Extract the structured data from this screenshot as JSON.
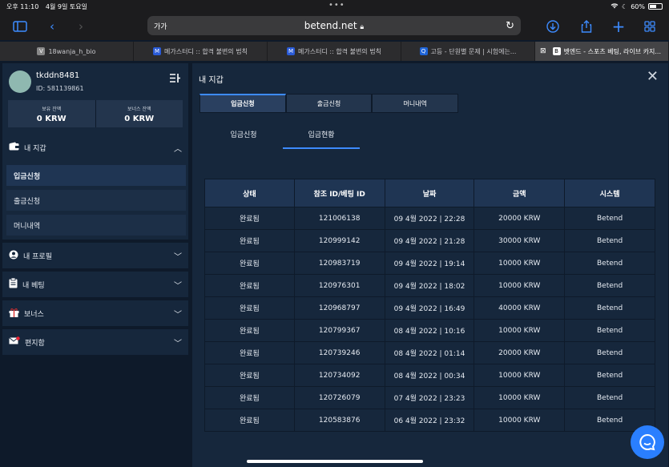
{
  "status": {
    "time": "오후 11:10",
    "date": "4월 9일 토요일",
    "battery": "60%",
    "battery_level": 0.6
  },
  "browser": {
    "aa": "가가",
    "url": "betend.net",
    "tabs": [
      {
        "label": "18wanja_h_bio",
        "fav": "V"
      },
      {
        "label": "메가스터디 :: 합격 불변의 법칙",
        "fav": "M"
      },
      {
        "label": "메가스터디 :: 합격 불변의 법칙",
        "fav": "M"
      },
      {
        "label": "고등 - 단원별 문제 | 시험에는...",
        "fav": "Q"
      },
      {
        "label": "벳엔드 - 스포츠 베팅, 라이브 카지...",
        "fav": "B"
      }
    ]
  },
  "user": {
    "name": "tkddn8481",
    "id": "ID: 581139861"
  },
  "balances": [
    {
      "label": "보유 잔액",
      "value": "0 KRW"
    },
    {
      "label": "보너스 잔액",
      "value": "0 KRW"
    }
  ],
  "sidebar": {
    "wallet": "내 지갑",
    "wallet_items": [
      "입금신청",
      "출금신청",
      "머니내역"
    ],
    "sections": [
      {
        "label": "내 프로필",
        "icon": "user-icon"
      },
      {
        "label": "내 베팅",
        "icon": "clipboard-icon"
      },
      {
        "label": "보너스",
        "icon": "gift-icon"
      },
      {
        "label": "편지함",
        "icon": "mail-icon"
      }
    ]
  },
  "main": {
    "title": "내 지갑",
    "tabs": [
      "입금신청",
      "출금신청",
      "머니내역"
    ],
    "subtabs": [
      "입금신청",
      "입금현황"
    ],
    "columns": [
      "상태",
      "참조 ID/베팅 ID",
      "날짜",
      "금액",
      "시스템"
    ],
    "rows": [
      [
        "완료됨",
        "121006138",
        "09 4월 2022 | 22:28",
        "20000 KRW",
        "Betend"
      ],
      [
        "완료됨",
        "120999142",
        "09 4월 2022 | 21:28",
        "30000 KRW",
        "Betend"
      ],
      [
        "완료됨",
        "120983719",
        "09 4월 2022 | 19:14",
        "10000 KRW",
        "Betend"
      ],
      [
        "완료됨",
        "120976301",
        "09 4월 2022 | 18:02",
        "10000 KRW",
        "Betend"
      ],
      [
        "완료됨",
        "120968797",
        "09 4월 2022 | 16:49",
        "40000 KRW",
        "Betend"
      ],
      [
        "완료됨",
        "120799367",
        "08 4월 2022 | 10:16",
        "10000 KRW",
        "Betend"
      ],
      [
        "완료됨",
        "120739246",
        "08 4월 2022 | 01:14",
        "20000 KRW",
        "Betend"
      ],
      [
        "완료됨",
        "120734092",
        "08 4월 2022 | 00:34",
        "10000 KRW",
        "Betend"
      ],
      [
        "완료됨",
        "120726079",
        "07 4월 2022 | 23:23",
        "10000 KRW",
        "Betend"
      ],
      [
        "완료됨",
        "120583876",
        "06 4월 2022 | 23:32",
        "10000 KRW",
        "Betend"
      ]
    ]
  }
}
